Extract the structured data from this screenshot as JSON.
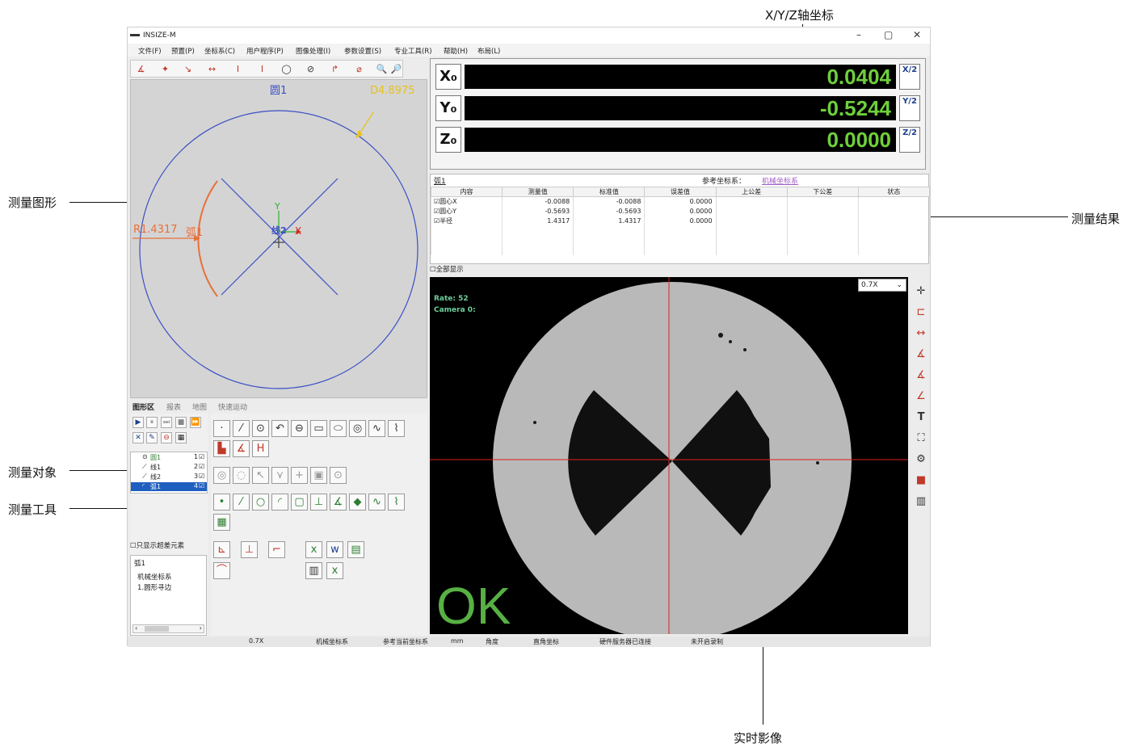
{
  "callouts": {
    "xyz": "X/Y/Z轴坐标",
    "graphic": "测量图形",
    "results": "测量结果",
    "objects": "测量对象",
    "tools": "测量工具",
    "camera": "实时影像"
  },
  "window": {
    "title": "INSIZE-M",
    "minimize": "–",
    "restore": "▢",
    "close": "✕"
  },
  "menu": [
    "文件(F)",
    "预置(P)",
    "坐标系(C)",
    "用户程序(P)",
    "图像处理(I)",
    "参数设置(S)",
    "专业工具(R)",
    "帮助(H)",
    "布局(L)"
  ],
  "graphic": {
    "circle_label": "圆1",
    "diameter_label": "D4.8975",
    "radius_label": "R1.4317",
    "arc_label": "弧1",
    "line_label": "线2",
    "axis_x": "X",
    "axis_y": "Y"
  },
  "tabs": [
    "图形区",
    "报表",
    "地图",
    "快速运动"
  ],
  "objects": [
    {
      "name": "圆1",
      "num": "1"
    },
    {
      "name": "线1",
      "num": "2"
    },
    {
      "name": "线2",
      "num": "3"
    },
    {
      "name": "弧1",
      "num": "4"
    }
  ],
  "only_show_label": "只显示超差元素",
  "coord_box": {
    "title": "弧1",
    "line1": "机械坐标系",
    "line2": "1.圆形寻边"
  },
  "dro": {
    "x_label": "X₀",
    "y_label": "Y₀",
    "z_label": "Z₀",
    "x_value": "0.0404",
    "y_value": "-0.5244",
    "z_value": "0.0000",
    "x_half": "X/2",
    "y_half": "Y/2",
    "z_half": "Z/2"
  },
  "results": {
    "element": "弧1",
    "ref_label": "参考坐标系：",
    "ref_value": "机械坐标系",
    "headers": [
      "内容",
      "测量值",
      "标准值",
      "误差值",
      "上公差",
      "下公差",
      "状态"
    ],
    "rows": [
      [
        "圆心X",
        "-0.0088",
        "-0.0088",
        "0.0000",
        "",
        "",
        ""
      ],
      [
        "圆心Y",
        "-0.5693",
        "-0.5693",
        "0.0000",
        "",
        "",
        ""
      ],
      [
        "半径",
        "1.4317",
        "1.4317",
        "0.0000",
        "",
        "",
        ""
      ]
    ],
    "show_all": "全部显示"
  },
  "camera": {
    "zoom": "0.7X",
    "rate": "Rate: 52",
    "camera": "Camera 0:",
    "status": "OK"
  },
  "statusbar": [
    "0.7X",
    "机械坐标系",
    "参考当前坐标系",
    "mm",
    "角度",
    "直角坐标",
    "硬件服务器已连接",
    "未开启录制"
  ],
  "colors": {
    "dro_digits": "#6ecf3b",
    "ok_text": "#57b043",
    "graphic_blue": "#3b4fc4",
    "arc_orange": "#e8703a",
    "dim_yellow": "#e6c21c",
    "crosshair_red": "#e02020"
  }
}
